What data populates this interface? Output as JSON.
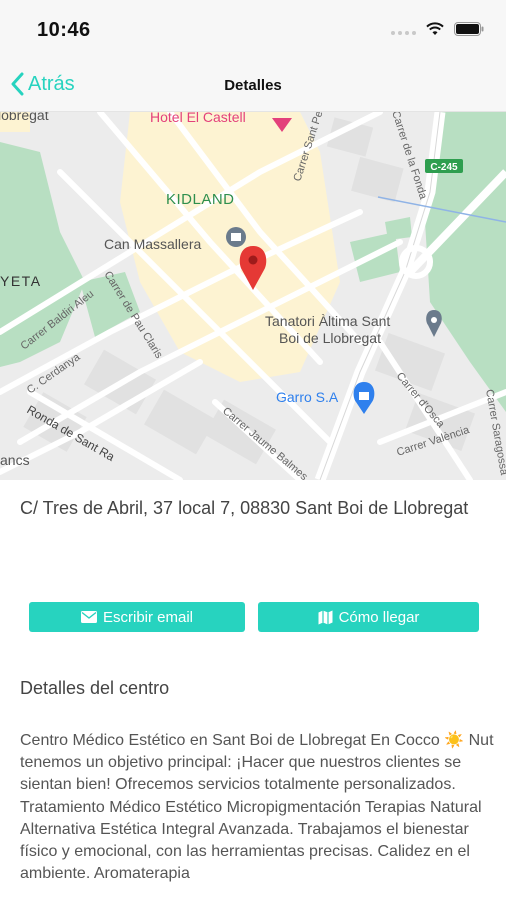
{
  "status_bar": {
    "time": "10:46",
    "icons": [
      "cellular-signal-icon",
      "wifi-icon",
      "battery-icon"
    ]
  },
  "nav": {
    "back_label": "Atrás",
    "title": "Detalles",
    "back_icon": "chevron-left-icon"
  },
  "map": {
    "labels": {
      "hotel": "Hotel El Castell",
      "kidland": "KIDLAND",
      "can_massallera": "Can Massallera",
      "tanatori_line1": "Tanatori Àltima Sant",
      "tanatori_line2": "Boi de Llobregat",
      "garro": "Garro S.A",
      "road_c245": "C-245",
      "yeta": "YETA",
      "lobregat": "lobregat",
      "ancs": "ancs",
      "carrer_sant_pe": "Carrer Sant Pe",
      "carrer_pau_claris": "Carrer de Pau Claris",
      "carrer_baldiri": "Carrer Baldiri Aleu",
      "cerdanya": "C. Cerdanya",
      "ronda": "Ronda de Sant Ra",
      "jaume_balmes": "Carrer Jaume Balmes",
      "osca": "Carrer d'Osca",
      "valencia": "Carrer València",
      "saragossa": "Carrer Saragossa",
      "fonda": "Carrer de la Fonda"
    },
    "colors": {
      "park": "#b8dfc2",
      "block": "#fdf3d2",
      "road": "#ffffff",
      "highway": "#ffffff",
      "pin": "#e53935",
      "poi": "#6b7b8c",
      "garro_poi": "#2f80ed",
      "hotel_poi": "#e3407b"
    }
  },
  "address": "C/ Tres de Abril, 37 local 7, 08830 Sant Boi de Llobregat",
  "buttons": {
    "email_label": "Escribir email",
    "route_label": "Cómo llegar",
    "email_icon": "envelope-icon",
    "route_icon": "map-icon"
  },
  "details": {
    "title": "Detalles del centro",
    "description": "Centro Médico Estético en Sant Boi de Llobregat  En Cocco ☀️ Nut tenemos un objetivo principal:   ¡Hacer que nuestros clientes se sientan bien!    Ofrecemos servicios totalmente personalizados.     Tratamiento Médico Estético  Micropigmentación  Terapias Natural Alternativa  Estética Integral Avanzada.     Trabajamos el bienestar físico y emocional, con las herramientas precisas.     Calidez en el ambiente. Aromaterapia"
  },
  "theme": {
    "accent": "#27d3bf"
  }
}
